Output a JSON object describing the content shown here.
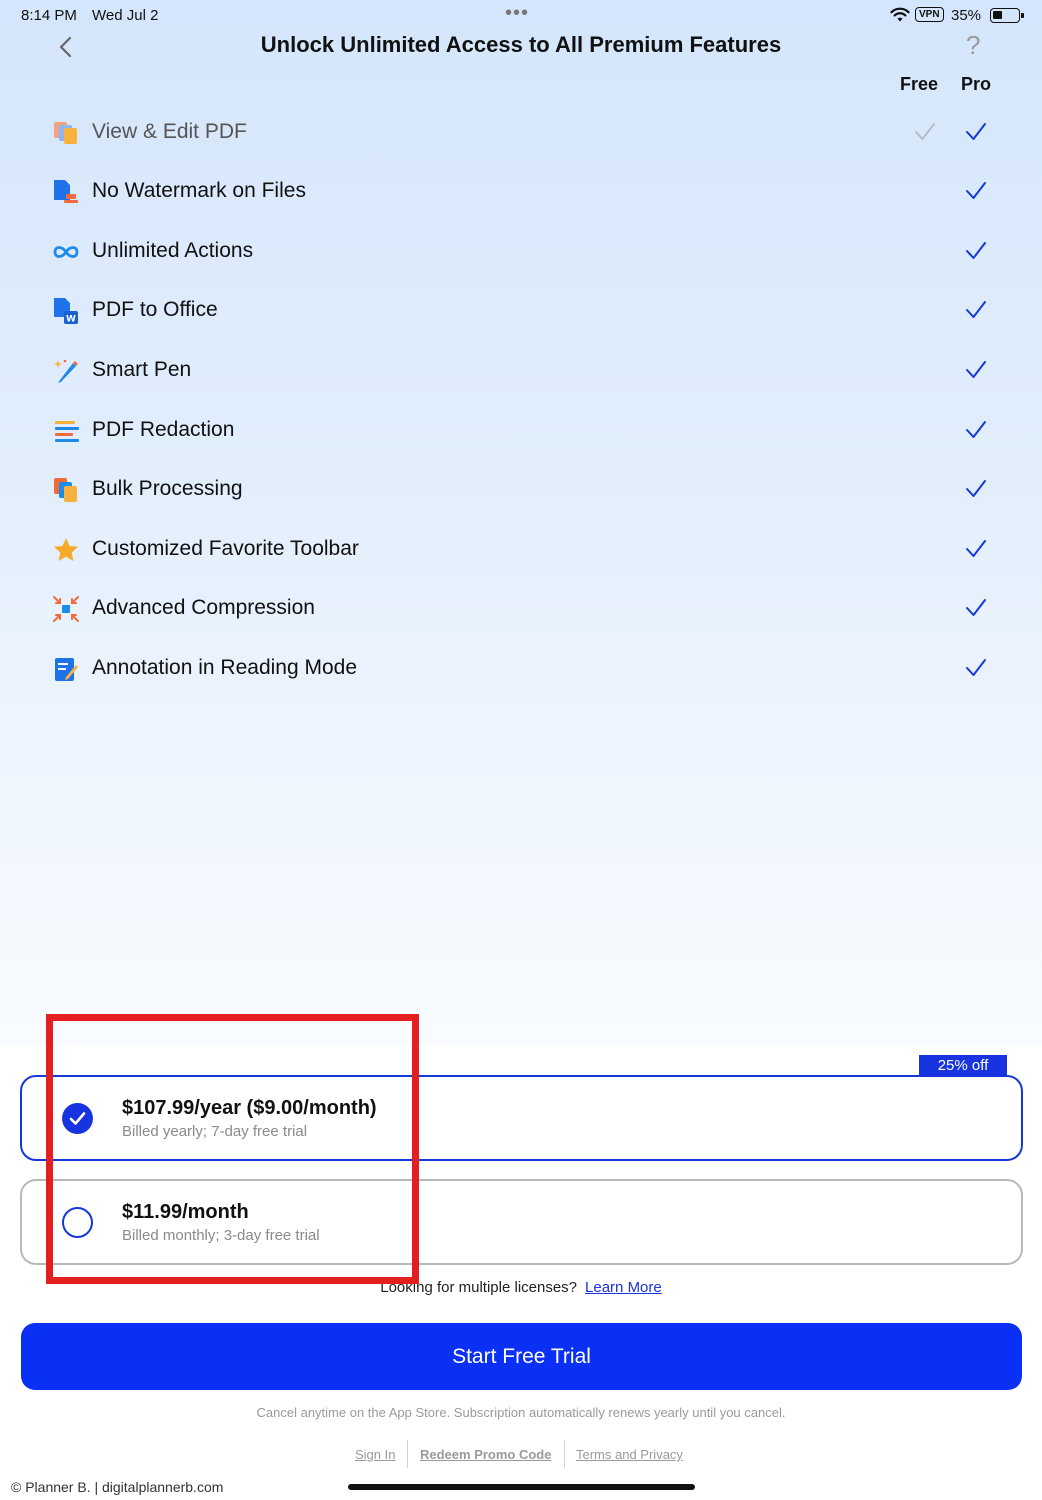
{
  "status_bar": {
    "time": "8:14 PM",
    "date": "Wed Jul 2",
    "vpn": "VPN",
    "battery": "35%"
  },
  "header": {
    "title": "Unlock Unlimited Access to All Premium Features",
    "help": "?",
    "col_free": "Free",
    "col_pro": "Pro"
  },
  "features": [
    {
      "label": "View & Edit PDF",
      "icon": "pages-icon",
      "free": true,
      "pro": true
    },
    {
      "label": "No Watermark on Files",
      "icon": "stamp-file-icon",
      "free": false,
      "pro": true
    },
    {
      "label": "Unlimited Actions",
      "icon": "infinity-icon",
      "free": false,
      "pro": true
    },
    {
      "label": "PDF to Office",
      "icon": "convert-word-icon",
      "free": false,
      "pro": true
    },
    {
      "label": "Smart Pen",
      "icon": "magic-pen-icon",
      "free": false,
      "pro": true
    },
    {
      "label": "PDF Redaction",
      "icon": "redaction-lines-icon",
      "free": false,
      "pro": true
    },
    {
      "label": "Bulk Processing",
      "icon": "stack-files-icon",
      "free": false,
      "pro": true
    },
    {
      "label": "Customized Favorite Toolbar",
      "icon": "star-icon",
      "free": false,
      "pro": true
    },
    {
      "label": "Advanced Compression",
      "icon": "compress-arrows-icon",
      "free": false,
      "pro": true
    },
    {
      "label": "Annotation in Reading Mode",
      "icon": "edit-note-icon",
      "free": false,
      "pro": true
    }
  ],
  "plans": {
    "badge": "25% off",
    "yearly": {
      "price": "$107.99/year ($9.00/month)",
      "subtitle": "Billed yearly; 7-day free trial",
      "selected": true
    },
    "monthly": {
      "price": "$11.99/month",
      "subtitle": "Billed monthly; 3-day free trial",
      "selected": false
    }
  },
  "licenses": {
    "text": "Looking for multiple licenses?",
    "link": "Learn More"
  },
  "cta": {
    "label": "Start Free Trial"
  },
  "cancel_note": "Cancel anytime on the App Store. Subscription automatically renews yearly until you cancel.",
  "footer": {
    "sign_in": "Sign In",
    "redeem": "Redeem Promo Code",
    "terms": "Terms and Privacy"
  },
  "copyright": "© Planner B. | digitalplannerb.com",
  "colors": {
    "accent": "#0a2ff5",
    "check": "#1538d9",
    "highlight": "#e41f1f"
  }
}
